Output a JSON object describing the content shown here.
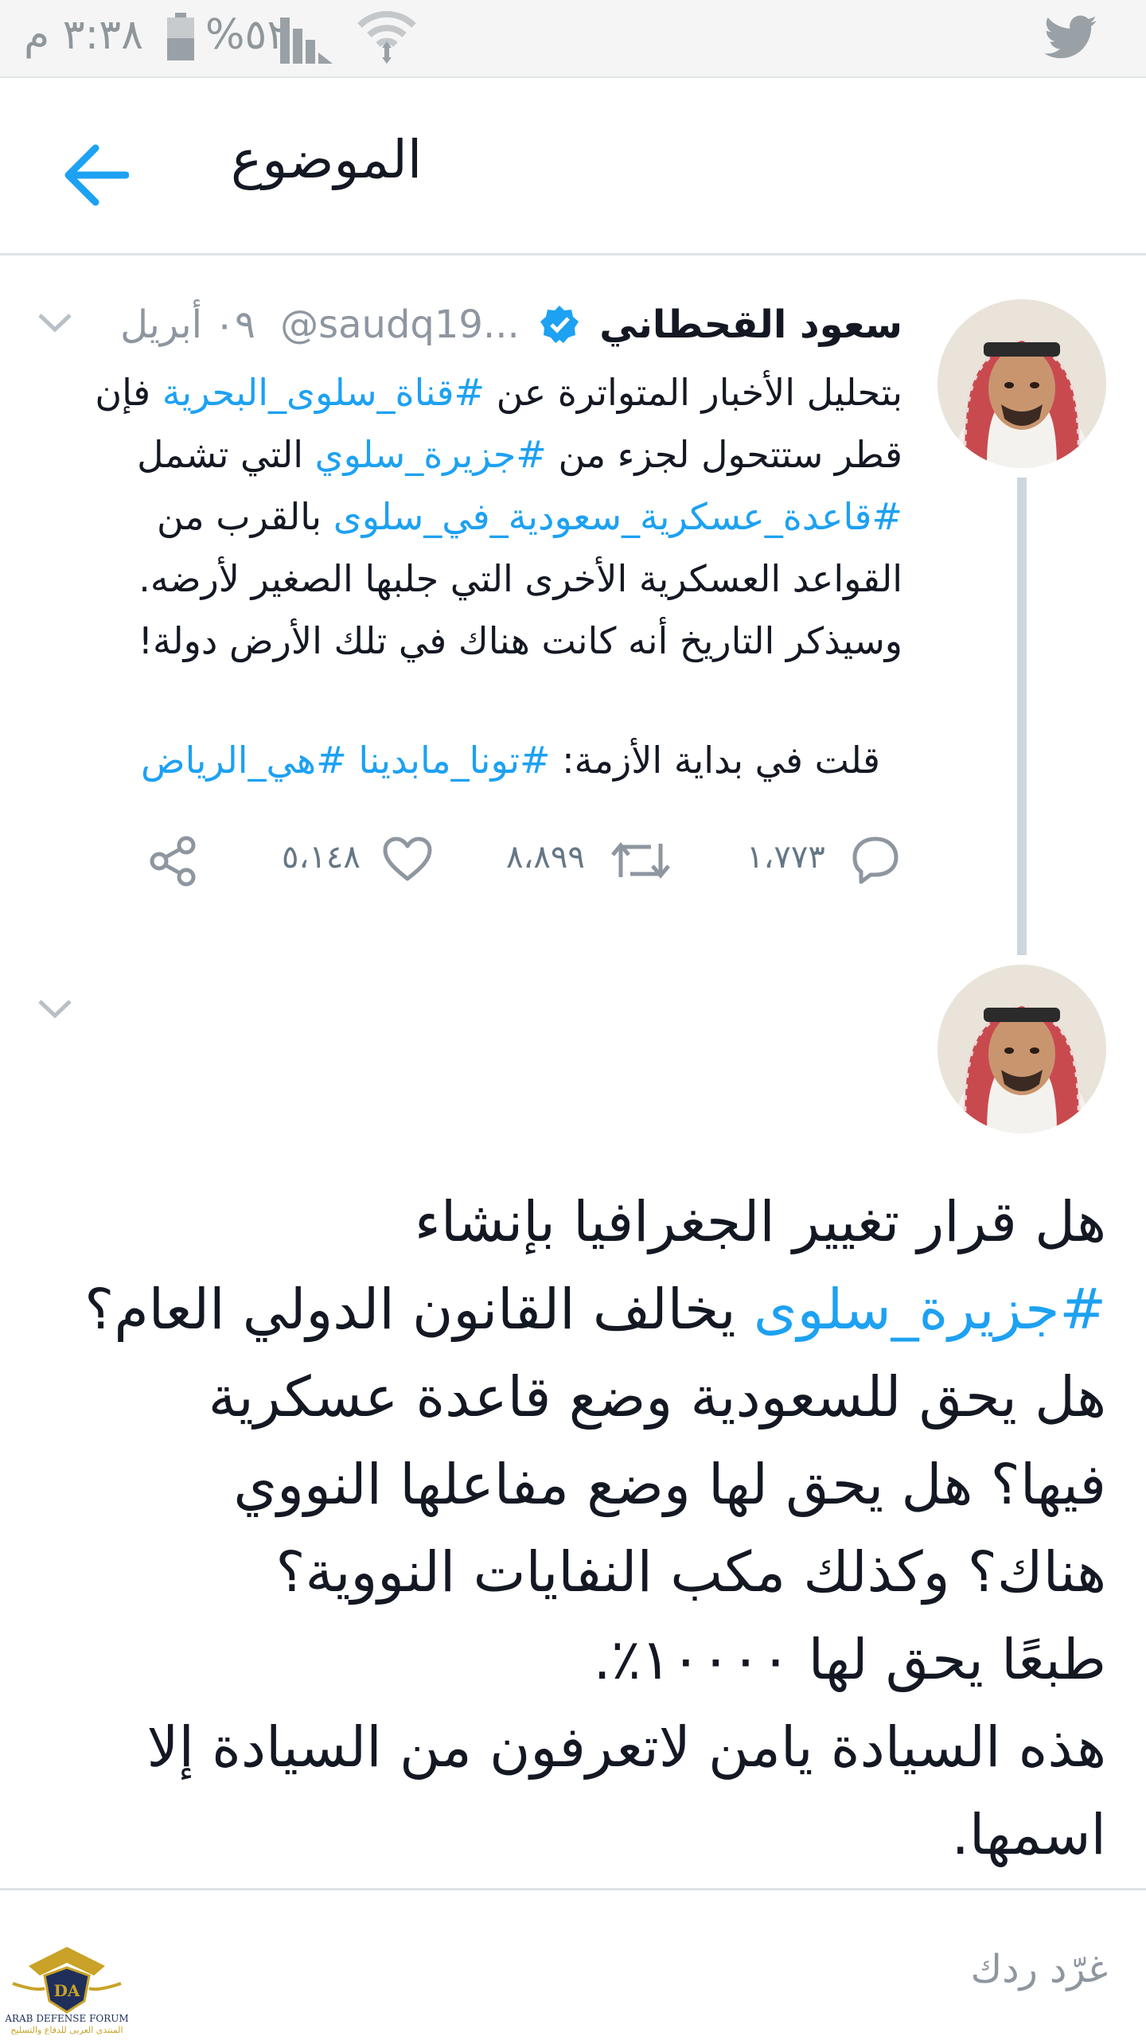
{
  "status_bar": {
    "time": "٣:٣٨ م",
    "battery_percent": "%٥٢",
    "icons": [
      "twitter-icon",
      "wifi-icon",
      "signal-icon",
      "battery-icon"
    ]
  },
  "header": {
    "title": "الموضوع",
    "back_icon": "back-arrow-icon"
  },
  "tweet": {
    "author_name": "سعود القحطاني",
    "handle": "@saudq19...",
    "date": "٠٩ أبريل",
    "body_parts": [
      {
        "text": "بتحليل الأخبار المتواترة عن "
      },
      {
        "text": "#قناة_سلوى_البحرية",
        "hashtag": true
      },
      {
        "text": " فإن قطر ستتحول لجزء من "
      },
      {
        "text": "#جزيرة_سلوي",
        "hashtag": true
      },
      {
        "text": " التي تشمل "
      },
      {
        "text": "#قاعدة_عسكرية_سعودية_في_سلوى",
        "hashtag": true
      },
      {
        "text": " بالقرب من القواعد العسكرية الأخرى التي جلبها الصغير لأرضه. وسيذكر التاريخ أنه كانت هناك في تلك الأرض دولة!"
      }
    ],
    "quote_parts": [
      {
        "text": "قلت في بداية الأزمة: "
      },
      {
        "text": "#تونا_مابدينا",
        "hashtag": true
      },
      {
        "text": " "
      },
      {
        "text": "#هي_الرياض",
        "hashtag": true
      }
    ],
    "replies": "١،٧٧٣",
    "retweets": "٨،٨٩٩",
    "likes": "٥،١٤٨"
  },
  "reply_tweet": {
    "lines": [
      [
        {
          "text": "هل قرار تغيير الجغرافيا بإنشاء"
        }
      ],
      [
        {
          "text": "#جزيرة_سلوى",
          "hashtag": true
        },
        {
          "text": " يخالف القانون الدولي العام؟"
        }
      ],
      [
        {
          "text": "هل يحق للسعودية وضع قاعدة عسكرية"
        }
      ],
      [
        {
          "text": "فيها؟ هل يحق لها وضع مفاعلها النووي"
        }
      ],
      [
        {
          "text": "هناك؟ وكذلك مكب النفايات النووية؟"
        }
      ],
      [
        {
          "text": "طبعًا يحق لها ١٠٠٠٠٪."
        }
      ],
      [
        {
          "text": "هذه السيادة يامن لاتعرفون من السيادة إلا"
        }
      ],
      [
        {
          "text": "اسمها."
        }
      ]
    ]
  },
  "reply_bar": {
    "placeholder": "غرّد ردك"
  },
  "watermark": {
    "line1": "ARAB DEFENSE FORUM",
    "line2": "المنتدى العربي للدفاع والتسليح",
    "mark": "DA"
  },
  "colors": {
    "accent": "#1da1f2",
    "text": "#141823",
    "muted": "#8e96a0",
    "status_bar_bg": "#f5f5f5"
  }
}
